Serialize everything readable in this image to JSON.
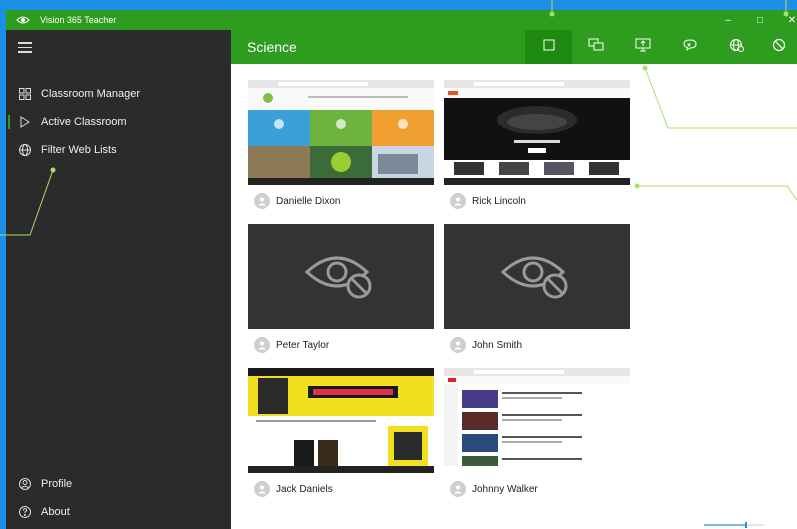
{
  "app": {
    "title": "Vision 365 Teacher"
  },
  "window_controls": {
    "minimize": "–",
    "maximize": "□",
    "close": "✕"
  },
  "sidebar": {
    "menu_icon": "hamburger-icon",
    "items": [
      {
        "label": "Classroom Manager",
        "icon": "grid-icon",
        "active": false
      },
      {
        "label": "Active Classroom",
        "icon": "play-icon",
        "active": true
      },
      {
        "label": "Filter Web Lists",
        "icon": "globe-icon",
        "active": false
      }
    ],
    "bottom": [
      {
        "label": "Profile",
        "icon": "person-icon"
      },
      {
        "label": "About",
        "icon": "help-icon"
      }
    ]
  },
  "header": {
    "title": "Science",
    "actions": [
      {
        "icon": "thumbnail-view-icon",
        "selected": true
      },
      {
        "icon": "windows-view-icon",
        "selected": false
      },
      {
        "icon": "share-screen-icon",
        "selected": false
      },
      {
        "icon": "message-icon",
        "selected": false
      },
      {
        "icon": "web-filter-icon",
        "selected": false
      },
      {
        "icon": "block-icon",
        "selected": false
      }
    ]
  },
  "students": [
    {
      "name": "Danielle Dixon",
      "screen": "website"
    },
    {
      "name": "Rick Lincoln",
      "screen": "microsoft-hololens"
    },
    {
      "name": "Peter Taylor",
      "screen": "blocked"
    },
    {
      "name": "John Smith",
      "screen": "blocked"
    },
    {
      "name": "Jack Daniels",
      "screen": "cyberpunk"
    },
    {
      "name": "Johnny Walker",
      "screen": "youtube"
    }
  ],
  "colors": {
    "accent": "#2e9c1f",
    "sidebar": "#2b2b2b",
    "background": "#1d8fe6"
  },
  "zoom": {
    "level": 0.7
  }
}
